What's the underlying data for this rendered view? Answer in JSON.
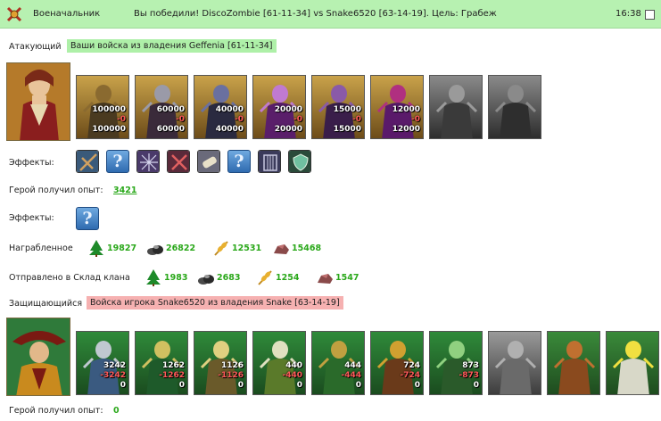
{
  "header": {
    "role": "Военачальник",
    "title": "Вы победили! DiscoZombie [61-11-34] vs Snake6520 [63-14-19]. Цель: Грабеж",
    "time": "16:38"
  },
  "attacker": {
    "label": "Атакующий",
    "tag": "Ваши войска из владения Geffenia [61-11-34]",
    "units": [
      {
        "icon": "brute-unit-icon",
        "count": "100000",
        "lost": "-0",
        "left": "100000"
      },
      {
        "icon": "ghoul-unit-icon",
        "count": "60000",
        "lost": "-0",
        "left": "60000"
      },
      {
        "icon": "dark-knight-unit-icon",
        "count": "40000",
        "lost": "-0",
        "left": "40000"
      },
      {
        "icon": "winged-demon-unit-icon",
        "count": "20000",
        "lost": "-0",
        "left": "20000"
      },
      {
        "icon": "dark-archer-unit-icon",
        "count": "15000",
        "lost": "-0",
        "left": "15000"
      },
      {
        "icon": "sorcerer-unit-icon",
        "count": "12000",
        "lost": "-0",
        "left": "12000"
      },
      {
        "icon": "shadow-knight-unit-icon",
        "count": "",
        "lost": "",
        "left": ""
      },
      {
        "icon": "spider-unit-icon",
        "count": "",
        "lost": "",
        "left": ""
      }
    ],
    "effects_label": "Эффекты:",
    "effects": [
      "crossbow-icon",
      "question-icon",
      "spider-web-icon",
      "crossed-axes-icon",
      "scroll-icon",
      "question-icon",
      "gate-icon",
      "shield-icon"
    ],
    "xp_label": "Герой получил опыт:",
    "xp_value": "3421"
  },
  "effects2": {
    "label": "Эффекты:",
    "items": [
      "question-icon"
    ]
  },
  "loot": {
    "label": "Награбленное",
    "items": [
      {
        "icon": "wood-icon",
        "value": "19827"
      },
      {
        "icon": "stone-icon",
        "value": "26822"
      },
      {
        "icon": "grain-icon",
        "value": "12531"
      },
      {
        "icon": "iron-icon",
        "value": "15468"
      }
    ]
  },
  "clan": {
    "label": "Отправлено в Склад клана",
    "items": [
      {
        "icon": "wood-icon",
        "value": "1983"
      },
      {
        "icon": "stone-icon",
        "value": "2683"
      },
      {
        "icon": "grain-icon",
        "value": "1254"
      },
      {
        "icon": "iron-icon",
        "value": "1547"
      }
    ]
  },
  "defender": {
    "label": "Защищающийся",
    "tag": "Войска игрока Snake6520 из владения Snake [63-14-19]",
    "units": [
      {
        "icon": "dwarf-unit-icon",
        "count": "3242",
        "lost": "-3242",
        "left": "0"
      },
      {
        "icon": "elf-swordsman-unit-icon",
        "count": "1262",
        "lost": "-1262",
        "left": "0"
      },
      {
        "icon": "elf-spearman-unit-icon",
        "count": "1126",
        "lost": "-1126",
        "left": "0"
      },
      {
        "icon": "griffin-unit-icon",
        "count": "440",
        "lost": "-440",
        "left": "0"
      },
      {
        "icon": "elf-archer-unit-icon",
        "count": "444",
        "lost": "-444",
        "left": "0"
      },
      {
        "icon": "druid-unit-icon",
        "count": "724",
        "lost": "-724",
        "left": "0"
      },
      {
        "icon": "ranger-unit-icon",
        "count": "873",
        "lost": "-873",
        "left": "0"
      },
      {
        "icon": "treant-unit-icon",
        "count": "",
        "lost": "",
        "left": ""
      },
      {
        "icon": "ancient-tree-unit-icon",
        "count": "",
        "lost": "",
        "left": ""
      },
      {
        "icon": "spirit-tower-unit-icon",
        "count": "",
        "lost": "",
        "left": ""
      }
    ],
    "xp_label": "Герой получил опыт:",
    "xp_value": "0"
  },
  "colors": {
    "header_bg": "#b7f1b1",
    "attacker_tag": "#aef0a8",
    "defender_tag": "#f6b1b1",
    "resource_value": "#2aa81a",
    "loss_red": "#ff5a5a"
  }
}
